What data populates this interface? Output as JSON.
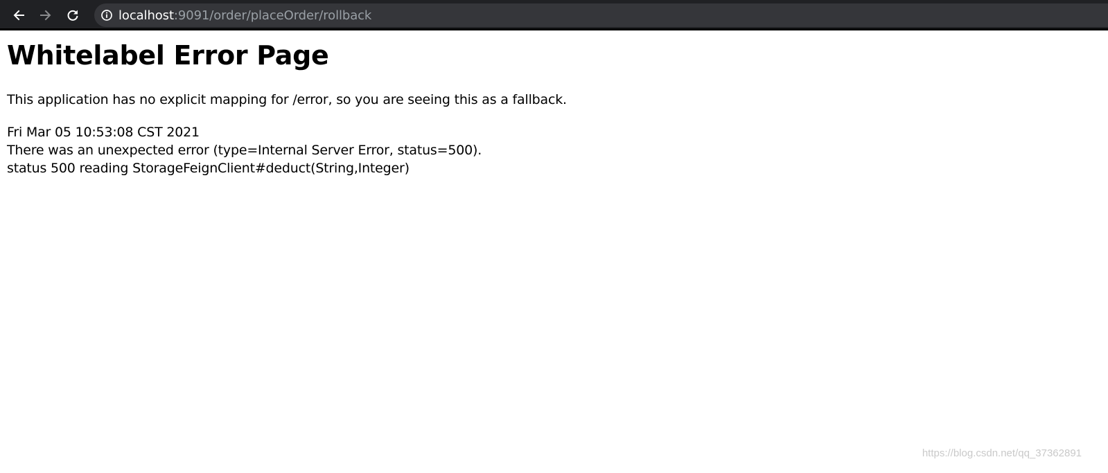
{
  "browser": {
    "url_host": "localhost",
    "url_path": ":9091/order/placeOrder/rollback",
    "back_icon": "arrow-left",
    "forward_icon": "arrow-right",
    "reload_icon": "reload",
    "site_info_icon": "info-circle"
  },
  "page": {
    "title": "Whitelabel Error Page",
    "message": "This application has no explicit mapping for /error, so you are seeing this as a fallback.",
    "timestamp": "Fri Mar 05 10:53:08 CST 2021",
    "error_line": "There was an unexpected error (type=Internal Server Error, status=500).",
    "detail_line": "status 500 reading StorageFeignClient#deduct(String,Integer)"
  },
  "watermark": "https://blog.csdn.net/qq_37362891"
}
